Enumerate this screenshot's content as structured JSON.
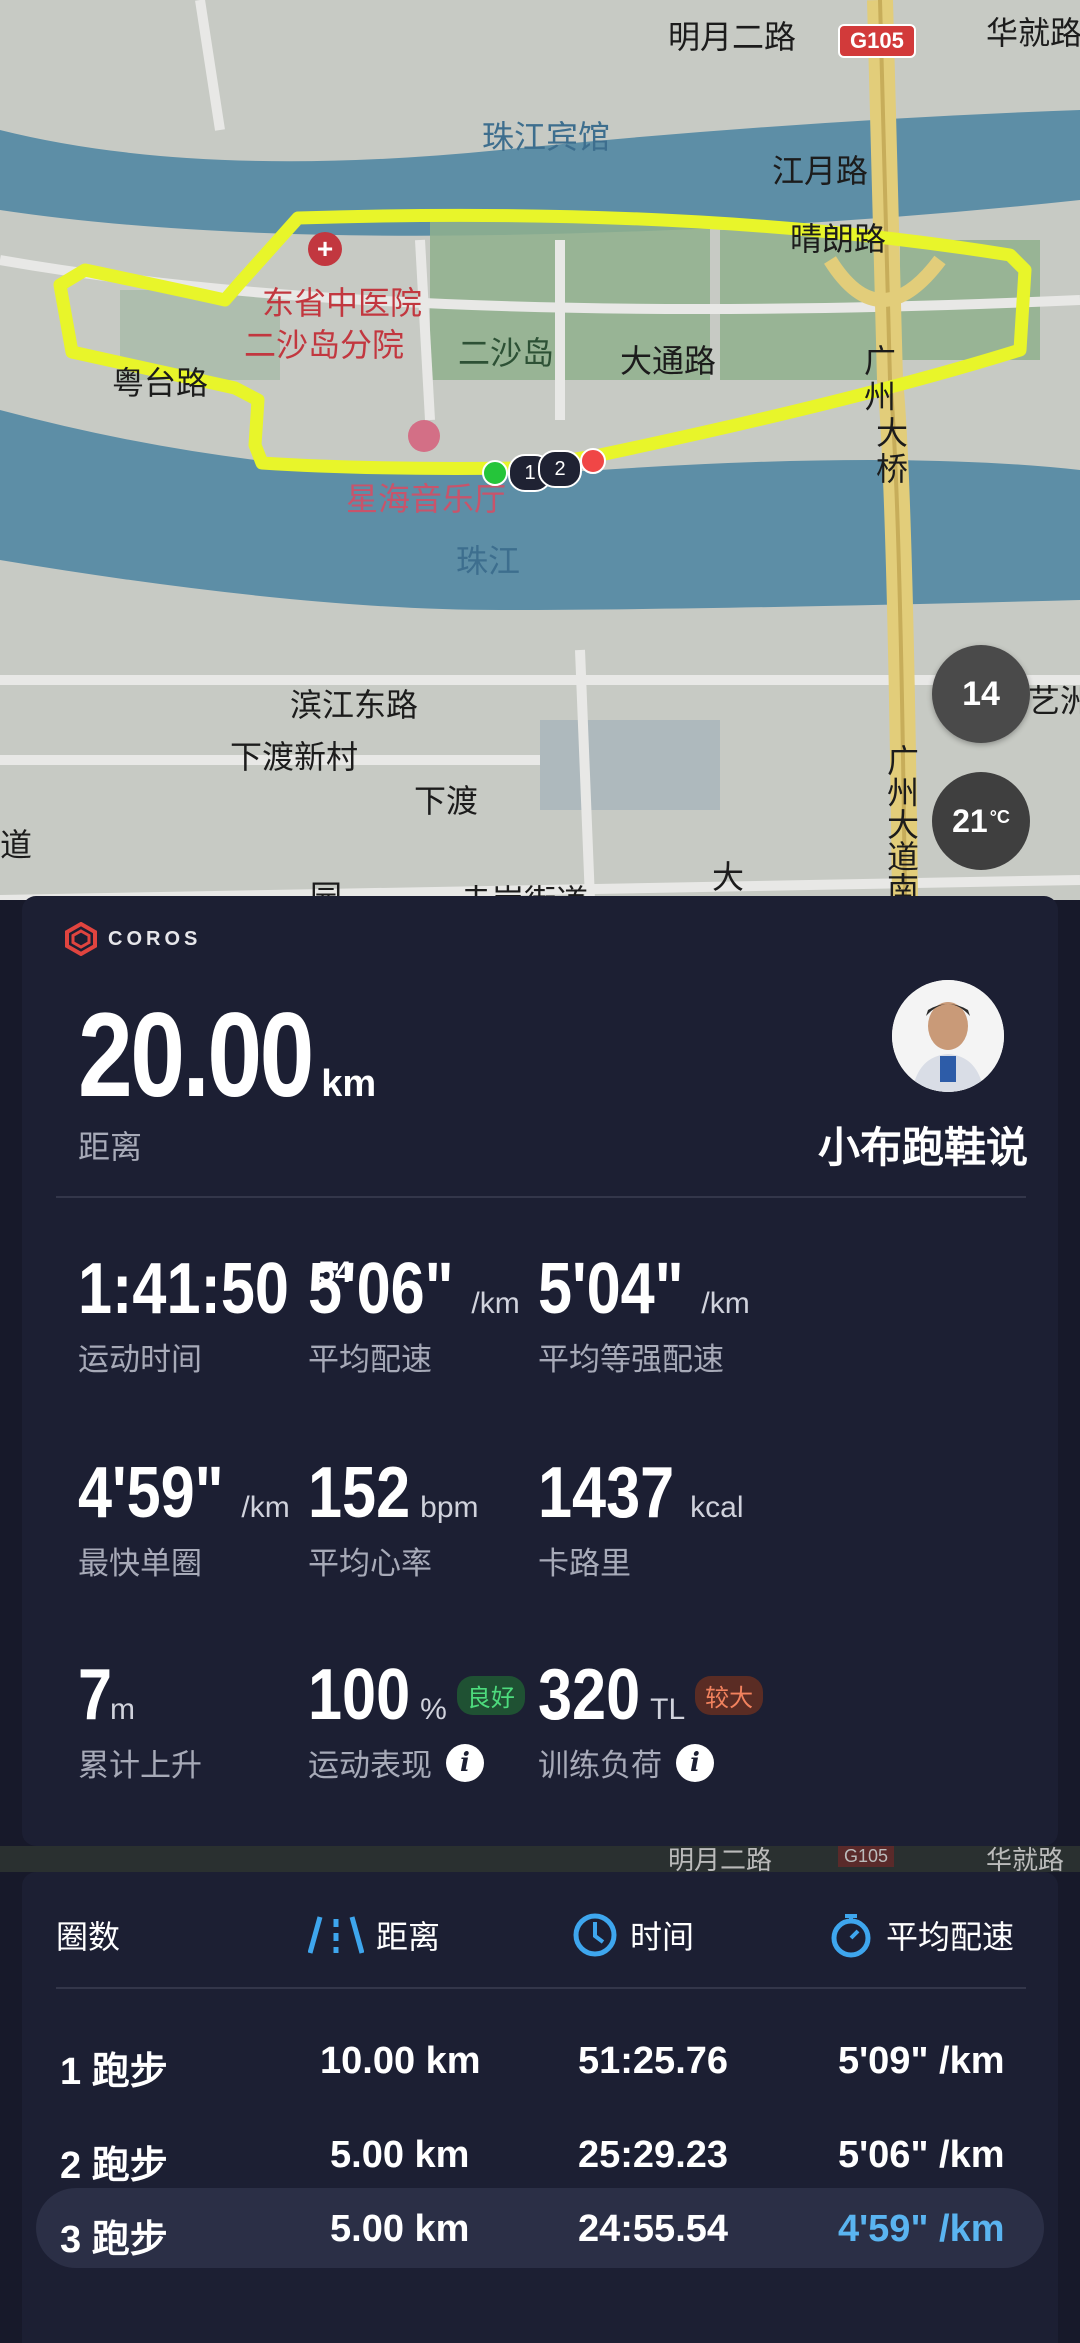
{
  "map": {
    "labels": {
      "mingyue": "明月二路",
      "g105": "G105",
      "huajiu": "华就路",
      "zhujiang_hotel": "珠江宾馆",
      "jiangyue": "江月路",
      "qinglang": "晴朗路",
      "tcm_hospital_1": "东省中医院",
      "tcm_hospital_2": "二沙岛分院",
      "ershadao": "二沙岛",
      "datong": "大通路",
      "yuetai": "粤台路",
      "guangzhou_bridge_1": "广",
      "guangzhou_bridge_2": "州",
      "guangzhou_bridge_3": "大",
      "guangzhou_bridge_4": "桥",
      "xinghai": "星海音乐厅",
      "zhujiang": "珠江",
      "binjiang_east": "滨江东路",
      "xiadu_village": "下渡新村",
      "xiadu": "下渡",
      "dadao_south": "广州大道南",
      "road_left": "道",
      "yizhou": "艺洲",
      "yuan": "园",
      "street": "赤岗街道",
      "da": "大"
    },
    "markers": {
      "lap1": "1",
      "lap2": "2"
    },
    "compass_value": "14",
    "temperature": "21",
    "temperature_unit": "°C",
    "colors": {
      "route": "#e8f52a",
      "river": "#5d8ea6",
      "green": "#8fb08d"
    }
  },
  "card": {
    "brand": "COROS",
    "distance": {
      "value": "20.00",
      "unit": "km",
      "label": "距离"
    },
    "user": {
      "name": "小布跑鞋说"
    },
    "stats": [
      {
        "value": "1:41:50",
        "sup": "54",
        "unit": "",
        "label": "运动时间"
      },
      {
        "value": "5'06\"",
        "unit": "/km",
        "label": "平均配速"
      },
      {
        "value": "5'04\"",
        "unit": "/km",
        "label": "平均等强配速"
      },
      {
        "value": "4'59\"",
        "unit": "/km",
        "label": "最快单圈"
      },
      {
        "value": "152",
        "unit": "bpm",
        "label": "平均心率"
      },
      {
        "value": "1437",
        "unit": "kcal",
        "label": "卡路里"
      },
      {
        "value": "7",
        "unit": "m",
        "label": "累计上升"
      },
      {
        "value": "100",
        "unit": "%",
        "badge": "良好",
        "label": "运动表现"
      },
      {
        "value": "320",
        "unit": "TL",
        "badge": "较大",
        "label": "训练负荷"
      }
    ]
  },
  "strip_text": {
    "mingyue": "明月二路",
    "g105": "G105",
    "huajiu": "华就路"
  },
  "laps": {
    "headers": {
      "lap": "圈数",
      "distance": "距离",
      "time": "时间",
      "pace": "平均配速"
    },
    "rows": [
      {
        "lap": "1 跑步",
        "distance": "10.00 km",
        "time": "51:25.76",
        "pace": "5'09\" /km"
      },
      {
        "lap": "2 跑步",
        "distance": "5.00 km",
        "time": "25:29.23",
        "pace": "5'06\" /km"
      },
      {
        "lap": "3 跑步",
        "distance": "5.00 km",
        "time": "24:55.54",
        "pace": "4'59\" /km"
      }
    ],
    "best_color": "#5ab4f0"
  }
}
